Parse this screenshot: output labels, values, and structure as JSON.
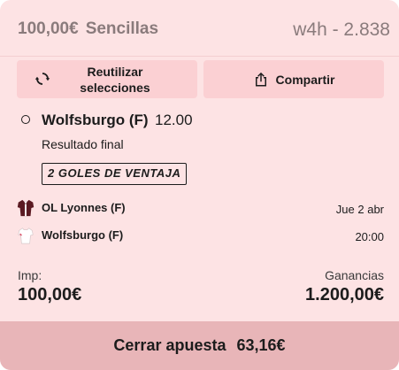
{
  "header": {
    "stake": "100,00€",
    "bet_type": "Sencillas",
    "bet_id": "w4h - 2.838"
  },
  "actions": {
    "reuse_label": "Reutilizar selecciones",
    "share_label": "Compartir"
  },
  "selection": {
    "team": "Wolfsburgo (F)",
    "odds": "12.00",
    "market": "Resultado final",
    "badge": "2 GOLES DE VENTAJA"
  },
  "match": {
    "home": "OL Lyonnes (F)",
    "away": "Wolfsburgo (F)",
    "date": "Jue 2 abr",
    "time": "20:00"
  },
  "stake": {
    "label": "Imp:",
    "value": "100,00€"
  },
  "winnings": {
    "label": "Ganancias",
    "value": "1.200,00€"
  },
  "cashout": {
    "label": "Cerrar apuesta",
    "amount": "63,16€"
  },
  "icons": {
    "reuse": "refresh-icon",
    "share": "share-icon",
    "home_jersey": "jersey-icon",
    "away_jersey": "jersey-icon"
  },
  "colors": {
    "card_bg": "#fde3e4",
    "button_bg": "#fbd0d3",
    "cashout_bg": "#e8b5b8"
  }
}
